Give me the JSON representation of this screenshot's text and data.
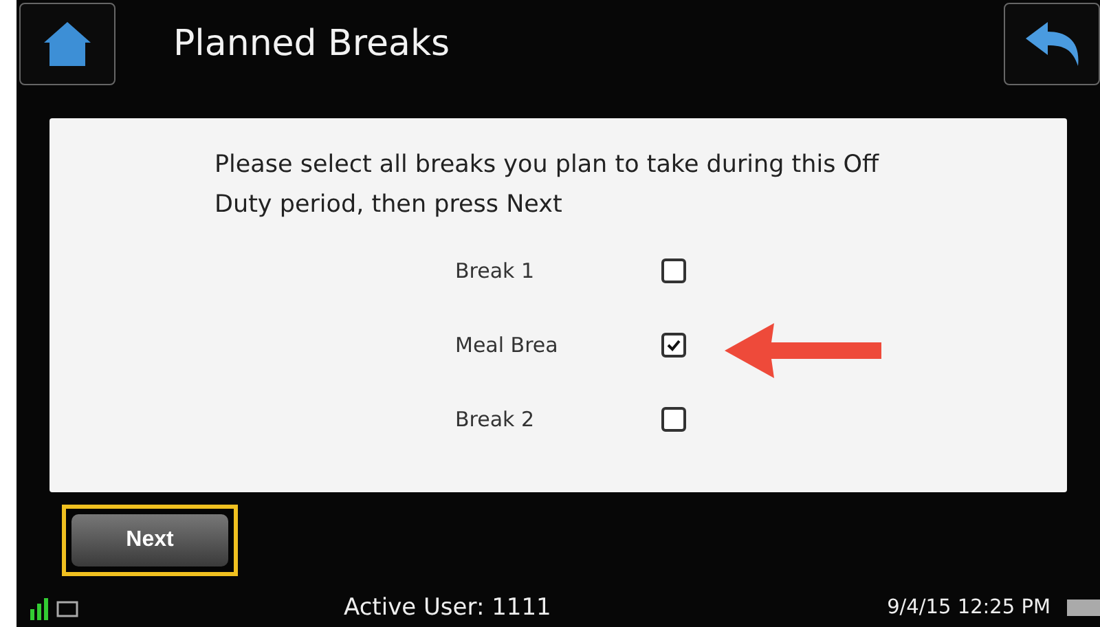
{
  "header": {
    "title": "Planned Breaks"
  },
  "instructions": "Please select all breaks you plan to take during this Off Duty period, then press Next",
  "breaks": [
    {
      "label": "Break 1",
      "checked": false
    },
    {
      "label": "Meal Brea",
      "checked": true
    },
    {
      "label": "Break 2",
      "checked": false
    }
  ],
  "next_button": {
    "label": "Next",
    "focused": true
  },
  "status_bar": {
    "user": "Active User: 1111",
    "datetime": "9/4/15 12:25 PM"
  }
}
